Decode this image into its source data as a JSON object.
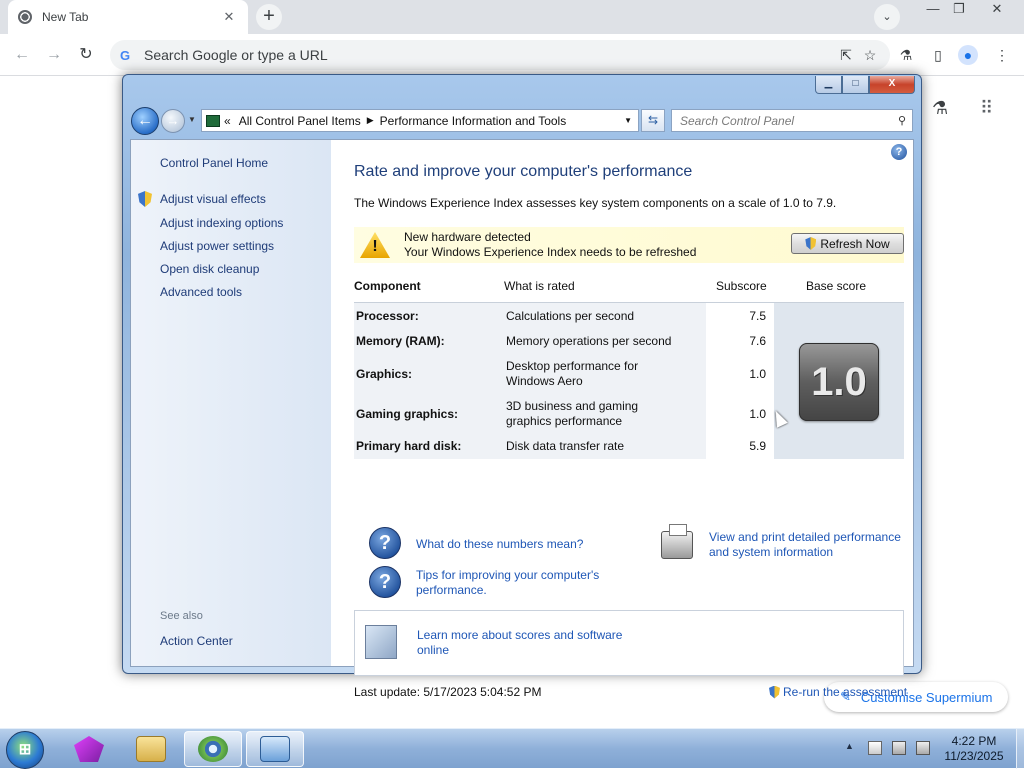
{
  "browser": {
    "tab_title": "New Tab",
    "tab_close": "✕",
    "new_tab": "+",
    "tab_search": "⌄",
    "omnibox_placeholder": "Search Google or type a URL",
    "g_logo": "G",
    "controls": {
      "minimize": "—",
      "restore": "❐",
      "close": "✕"
    }
  },
  "ntp": {
    "customise_label": "Customise Supermium",
    "customise_icon": "✎"
  },
  "control_panel": {
    "title_buttons": {
      "minimize": "▁",
      "maximize": "□",
      "close": "X"
    },
    "address": {
      "crumb_prefix": "«",
      "crumb_1": "All Control Panel Items",
      "crumb_sep": "▶",
      "crumb_2": "Performance Information and Tools",
      "dropdown": "▼"
    },
    "refresh_glyph": "⇆",
    "search_placeholder": "Search Control Panel",
    "sidebar": {
      "home": "Control Panel Home",
      "links": [
        "Adjust visual effects",
        "Adjust indexing options",
        "Adjust power settings",
        "Open disk cleanup",
        "Advanced tools"
      ],
      "see_also": "See also",
      "action_center": "Action Center"
    },
    "help_glyph": "?",
    "page_title": "Rate and improve your computer's performance",
    "wei_description": "The Windows Experience Index assesses key system components on a scale of 1.0 to 7.9.",
    "alert": {
      "icon": "!",
      "line1": "New hardware detected",
      "line2": "Your Windows Experience Index needs to be refreshed",
      "button": "Refresh Now"
    },
    "table": {
      "headers": {
        "component": "Component",
        "what": "What is rated",
        "subscore": "Subscore",
        "base": "Base score"
      },
      "rows": [
        {
          "component": "Processor:",
          "what": "Calculations per second",
          "subscore": "7.5"
        },
        {
          "component": "Memory (RAM):",
          "what": "Memory operations per second",
          "subscore": "7.6"
        },
        {
          "component": "Graphics:",
          "what": "Desktop performance for Windows Aero",
          "subscore": "1.0"
        },
        {
          "component": "Gaming graphics:",
          "what": "3D business and gaming graphics performance",
          "subscore": "1.0"
        },
        {
          "component": "Primary hard disk:",
          "what": "Disk data transfer rate",
          "subscore": "5.9"
        }
      ],
      "base_score": "1.0"
    },
    "links": {
      "numbers_meaning": "What do these numbers mean?",
      "tips": "Tips for improving your computer's performance.",
      "print_details": "View and print detailed performance and system information",
      "learn_more": "Learn more about scores and software online",
      "rerun": "Re-run the assessment"
    },
    "last_update": "Last update: 5/17/2023 5:04:52 PM"
  },
  "taskbar": {
    "start_glyph": "⊞",
    "time": "4:22 PM",
    "date": "11/23/2025",
    "tray_arrow": "▲"
  },
  "colors": {
    "link": "#1f57b6",
    "title": "#1f3f7a",
    "alert_bg": "#fffde1",
    "taskbar": "#8fb0d9"
  }
}
